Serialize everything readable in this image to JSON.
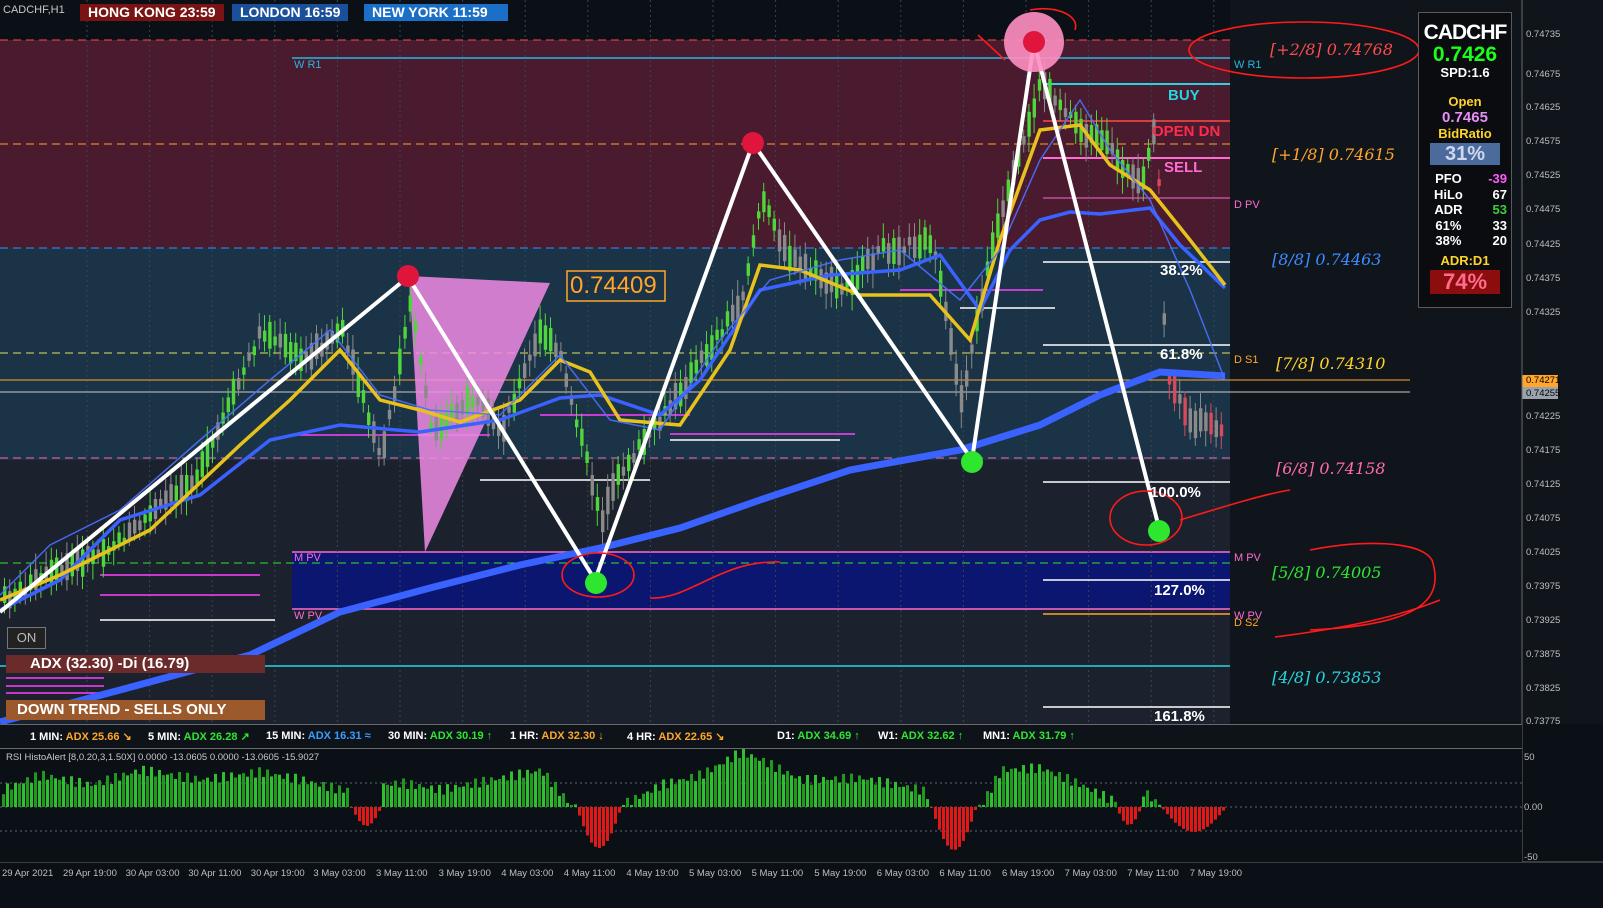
{
  "window": {
    "symbol_title": "CADCHF,H1"
  },
  "clocks": [
    {
      "label": "HONG KONG  23:59",
      "color": "#7a1414"
    },
    {
      "label": "LONDON  16:59",
      "color": "#1a4f9a"
    },
    {
      "label": "NEW YORK  11:59",
      "color": "#1c6fc6"
    }
  ],
  "side_panel": {
    "symbol": "CADCHF",
    "bid": "0.7426",
    "spread": "SPD:1.6",
    "open_label": "Open",
    "open_value": "0.7465",
    "bidratio_label": "BidRatio",
    "bidratio_value": "31%",
    "rows": [
      {
        "label": "PFO",
        "value": "-39",
        "color": "#ff5aff"
      },
      {
        "label": "HiLo",
        "value": "67",
        "color": "#ffffff"
      },
      {
        "label": "ADR",
        "value": "53",
        "color": "#3ccf3c"
      },
      {
        "label": "61%",
        "value": "33",
        "color": "#ffffff"
      },
      {
        "label": "38%",
        "value": "20",
        "color": "#ffffff"
      }
    ],
    "adr_label": "ADR:D1",
    "adr_value": "74%"
  },
  "murrey_levels": [
    {
      "label": "[+2/8]  0.74768",
      "color": "#ff4b4b"
    },
    {
      "label": "[+1/8]  0.74615",
      "color": "#ffa62b"
    },
    {
      "label": "[8/8]  0.74463",
      "color": "#3b8cff"
    },
    {
      "label": "[7/8]  0.74310",
      "color": "#ffd42a"
    },
    {
      "label": "[6/8]  0.74158",
      "color": "#ff6ba8"
    },
    {
      "label": "[5/8]  0.74005",
      "color": "#2ee62e"
    },
    {
      "label": "[4/8]  0.73853",
      "color": "#27d5e0"
    }
  ],
  "pivots": {
    "w_r1": "W R1",
    "d_pv": "D PV",
    "d_s1": "D S1",
    "m_pv": "M PV",
    "w_pv": "W PV",
    "d_s2": "D S2"
  },
  "signals": {
    "buy": "BUY",
    "open_dn": "OPEN DN",
    "sell": "SELL"
  },
  "fib_labels": [
    "38.2%",
    "61.8%",
    "100.0%",
    "127.0%",
    "161.8%"
  ],
  "price_tag": "0.74409",
  "on_button": "ON",
  "adx_box": "ADX (32.30)  -Di (16.79)",
  "trend_box": "DOWN TREND - SELLS ONLY",
  "adx_panel": [
    {
      "tf": "1 MIN:",
      "value": "ADX 25.66",
      "arrow": "↘",
      "color": "#ffa62b"
    },
    {
      "tf": "5 MIN:",
      "value": "ADX 26.28",
      "arrow": "↗",
      "color": "#2ee62e"
    },
    {
      "tf": "15 MIN:",
      "value": "ADX 16.31",
      "arrow": "≈",
      "color": "#3b9cff"
    },
    {
      "tf": "30 MIN:",
      "value": "ADX 30.19",
      "arrow": "↑",
      "color": "#2ee62e"
    },
    {
      "tf": "1 HR:",
      "value": "ADX 32.30",
      "arrow": "↓",
      "color": "#ffa62b"
    },
    {
      "tf": "4 HR:",
      "value": "ADX 22.65",
      "arrow": "↘",
      "color": "#ffa62b"
    },
    {
      "tf": "D1:",
      "value": "ADX 34.69",
      "arrow": "↑",
      "color": "#2ee62e"
    },
    {
      "tf": "W1:",
      "value": "ADX 32.62",
      "arrow": "↑",
      "color": "#2ee62e"
    },
    {
      "tf": "MN1:",
      "value": "ADX 31.79",
      "arrow": "↑",
      "color": "#2ee62e"
    }
  ],
  "rsi_title": "RSI HistoAlert [8,0.20,3,1.50X] 0.0000 -13.0605 0.0000 -13.0605 -15.9027",
  "rsi_axis": [
    "50",
    "0.00",
    "-50"
  ],
  "price_axis": [
    "0.74735",
    "0.74675",
    "0.74625",
    "0.74575",
    "0.74525",
    "0.74475",
    "0.74425",
    "0.74375",
    "0.74325",
    "0.74271",
    "0.74255",
    "0.74225",
    "0.74175",
    "0.74125",
    "0.74075",
    "0.74025",
    "0.73975",
    "0.73925",
    "0.73875",
    "0.73825",
    "0.73775"
  ],
  "time_axis": [
    "29 Apr 2021",
    "29 Apr 19:00",
    "30 Apr 03:00",
    "30 Apr 11:00",
    "30 Apr 19:00",
    "3 May 03:00",
    "3 May 11:00",
    "3 May 19:00",
    "4 May 03:00",
    "4 May 11:00",
    "4 May 19:00",
    "5 May 03:00",
    "5 May 11:00",
    "5 May 19:00",
    "6 May 03:00",
    "6 May 11:00",
    "6 May 19:00",
    "7 May 03:00",
    "7 May 11:00",
    "7 May 19:00"
  ]
}
